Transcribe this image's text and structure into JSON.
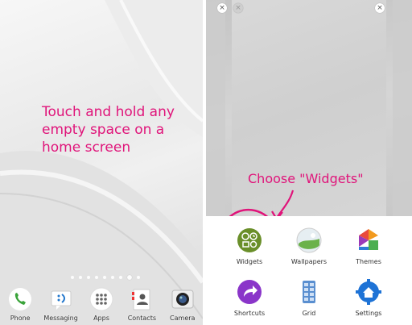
{
  "left_panel": {
    "instruction": "Touch and hold any empty space on a home screen",
    "page_indicator": {
      "count": 9,
      "active": 7
    },
    "dock": [
      {
        "label": "Phone",
        "icon": "phone-icon"
      },
      {
        "label": "Messaging",
        "icon": "messaging-icon"
      },
      {
        "label": "Apps",
        "icon": "apps-icon"
      },
      {
        "label": "Contacts",
        "icon": "contacts-icon"
      },
      {
        "label": "Camera",
        "icon": "camera-icon"
      }
    ]
  },
  "right_panel": {
    "instruction": "Choose \"Widgets\"",
    "menu": {
      "widgets": "Widgets",
      "wallpapers": "Wallpapers",
      "themes": "Themes",
      "shortcuts": "Shortcuts",
      "grid": "Grid",
      "settings": "Settings"
    },
    "close_symbol": "×"
  },
  "colors": {
    "annotation": "#e0147a",
    "widgets_green": "#6a8f2a",
    "shortcuts_purple": "#8a35c9",
    "settings_blue": "#1e73d6"
  }
}
